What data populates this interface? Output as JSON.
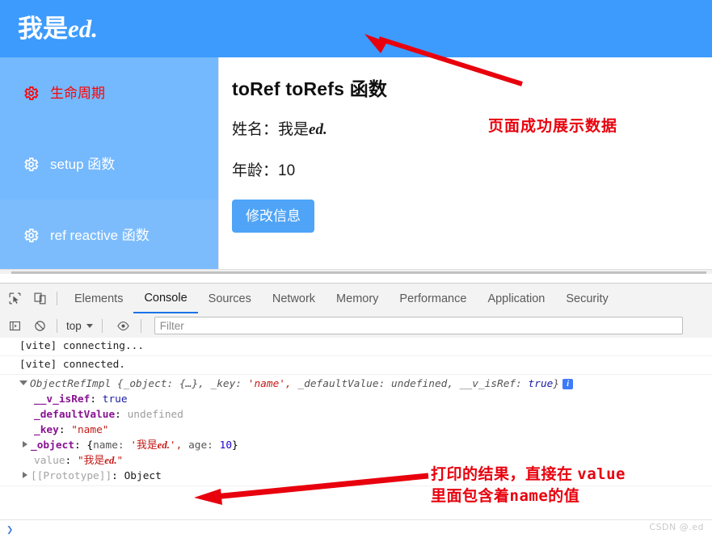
{
  "app": {
    "header_title_prefix": "我是",
    "header_title_italic": "ed.",
    "header_bg": "#3d9bfe"
  },
  "sidebar": {
    "bg": "#74b8fd",
    "active_color": "#ff0000",
    "items": [
      {
        "icon": "gear-icon",
        "label": "生命周期",
        "active": true
      },
      {
        "icon": "gear-icon",
        "label": "setup 函数",
        "active": false
      },
      {
        "icon": "gear-icon",
        "label": "ref reactive 函数",
        "active": false
      }
    ]
  },
  "content": {
    "title": "toRef toRefs 函数",
    "name_label": "姓名：",
    "name_value_prefix": "我是",
    "name_value_italic": "ed.",
    "age_label": "年龄：",
    "age_value": "10",
    "button_label": "修改信息",
    "button_bg": "#4fa4f7"
  },
  "annotations": {
    "top_text": "页面成功展示数据",
    "bottom_line1_a": "打印的结果，直接在 ",
    "bottom_line1_b": "value",
    "bottom_line2_a": "里面包含着",
    "bottom_line2_b": "name",
    "bottom_line2_c": "的值",
    "color": "#e8000d"
  },
  "devtools": {
    "inspect_icon": "inspect-element-icon",
    "device_icon": "device-toolbar-icon",
    "tabs": [
      {
        "label": "Elements",
        "active": false
      },
      {
        "label": "Console",
        "active": true
      },
      {
        "label": "Sources",
        "active": false
      },
      {
        "label": "Network",
        "active": false
      },
      {
        "label": "Memory",
        "active": false
      },
      {
        "label": "Performance",
        "active": false
      },
      {
        "label": "Application",
        "active": false
      },
      {
        "label": "Security",
        "active": false
      }
    ],
    "toolbar": {
      "sidebar_toggle_icon": "console-sidebar-icon",
      "clear_icon": "clear-console-icon",
      "context_label": "top",
      "eye_icon": "live-expression-icon",
      "filter_placeholder": "Filter",
      "filter_value": ""
    },
    "console": {
      "logs": [
        {
          "type": "text",
          "text": "[vite] connecting..."
        },
        {
          "type": "text",
          "text": "[vite] connected."
        }
      ],
      "object": {
        "summary_class": "ObjectRefImpl",
        "summary_open": "{",
        "summary_k1": "_object:",
        "summary_v1": "{…},",
        "summary_k2": "_key:",
        "summary_v2": "'name',",
        "summary_k3": "_defaultValue:",
        "summary_v3": "undefined,",
        "summary_k4": "__v_isRef:",
        "summary_v4": "true",
        "summary_close": "}",
        "info_badge": "i",
        "props": [
          {
            "key": "__v_isRef",
            "sep": ": ",
            "value": "true",
            "vclass": "v-bool",
            "expandable": false
          },
          {
            "key": "_defaultValue",
            "sep": ": ",
            "value": "undefined",
            "vclass": "v-undef",
            "expandable": false
          },
          {
            "key": "_key",
            "sep": ": ",
            "value": "\"name\"",
            "vclass": "v-str",
            "expandable": false
          }
        ],
        "object_prop": {
          "key": "_object",
          "sep": ": ",
          "brace_open": "{",
          "name_key": "name:",
          "name_value_q1": "'我是",
          "name_value_ital": "ed.",
          "name_value_q2": "',",
          "age_key": "age:",
          "age_value": "10",
          "brace_close": "}"
        },
        "value_prop": {
          "key": "value",
          "sep": ": ",
          "q1": "\"我是",
          "ital": "ed.",
          "q2": "\""
        },
        "prototype_prop": {
          "key": "[[Prototype]]",
          "sep": ": ",
          "value": "Object"
        }
      },
      "prompt_caret": "❯"
    }
  },
  "watermark": "CSDN @.ed"
}
